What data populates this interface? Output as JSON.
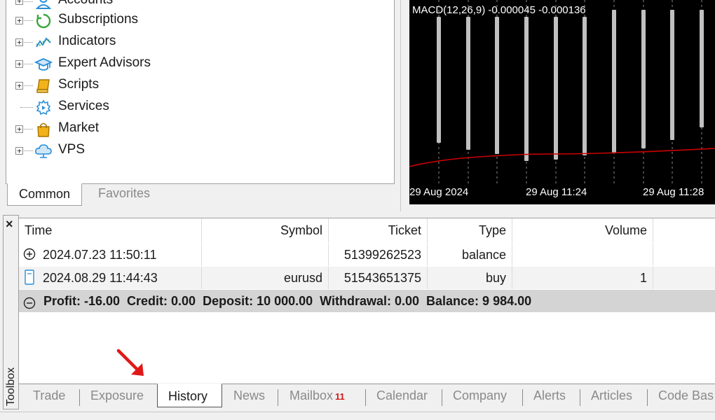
{
  "navigator": {
    "items": [
      {
        "label": "Accounts",
        "icon": "accounts-icon",
        "expandable": true
      },
      {
        "label": "Subscriptions",
        "icon": "subscriptions-icon",
        "expandable": true
      },
      {
        "label": "Indicators",
        "icon": "indicators-icon",
        "expandable": true
      },
      {
        "label": "Expert Advisors",
        "icon": "expert-advisors-icon",
        "expandable": true
      },
      {
        "label": "Scripts",
        "icon": "scripts-icon",
        "expandable": true
      },
      {
        "label": "Services",
        "icon": "services-icon",
        "expandable": false
      },
      {
        "label": "Market",
        "icon": "market-icon",
        "expandable": true
      },
      {
        "label": "VPS",
        "icon": "vps-icon",
        "expandable": true
      }
    ],
    "tabs": {
      "common": "Common",
      "favorites": "Favorites"
    }
  },
  "chart": {
    "indicator_label": "MACD(12,26,9) -0.000045 -0.000136",
    "time_labels": [
      "29 Aug 2024",
      "29 Aug 11:24",
      "29 Aug 11:28"
    ],
    "colors": {
      "background": "#000000",
      "histogram": "#c0c0c0",
      "signal": "#cc0000",
      "grid": "#8a8a8a"
    }
  },
  "toolbox": {
    "side_label": "Toolbox",
    "close_glyph": "×",
    "columns": {
      "time": "Time",
      "symbol": "Symbol",
      "ticket": "Ticket",
      "type": "Type",
      "volume": "Volume"
    },
    "rows": [
      {
        "icon": "plus-circle-icon",
        "time": "2024.07.23 11:50:11",
        "symbol": "",
        "ticket": "51399262523",
        "type": "balance",
        "volume": ""
      },
      {
        "icon": "document-icon",
        "time": "2024.08.29 11:44:43",
        "symbol": "eurusd",
        "ticket": "51543651375",
        "type": "buy",
        "volume": "1"
      }
    ],
    "summary": "Profit: -16.00  Credit: 0.00  Deposit: 10 000.00  Withdrawal: 0.00  Balance: 9 984.00",
    "tabs": {
      "trade": "Trade",
      "exposure": "Exposure",
      "history": "History",
      "news": "News",
      "mailbox": "Mailbox",
      "mailbox_count": "11",
      "calendar": "Calendar",
      "company": "Company",
      "alerts": "Alerts",
      "articles": "Articles",
      "code_base": "Code Bas"
    },
    "active_tab": "History"
  }
}
